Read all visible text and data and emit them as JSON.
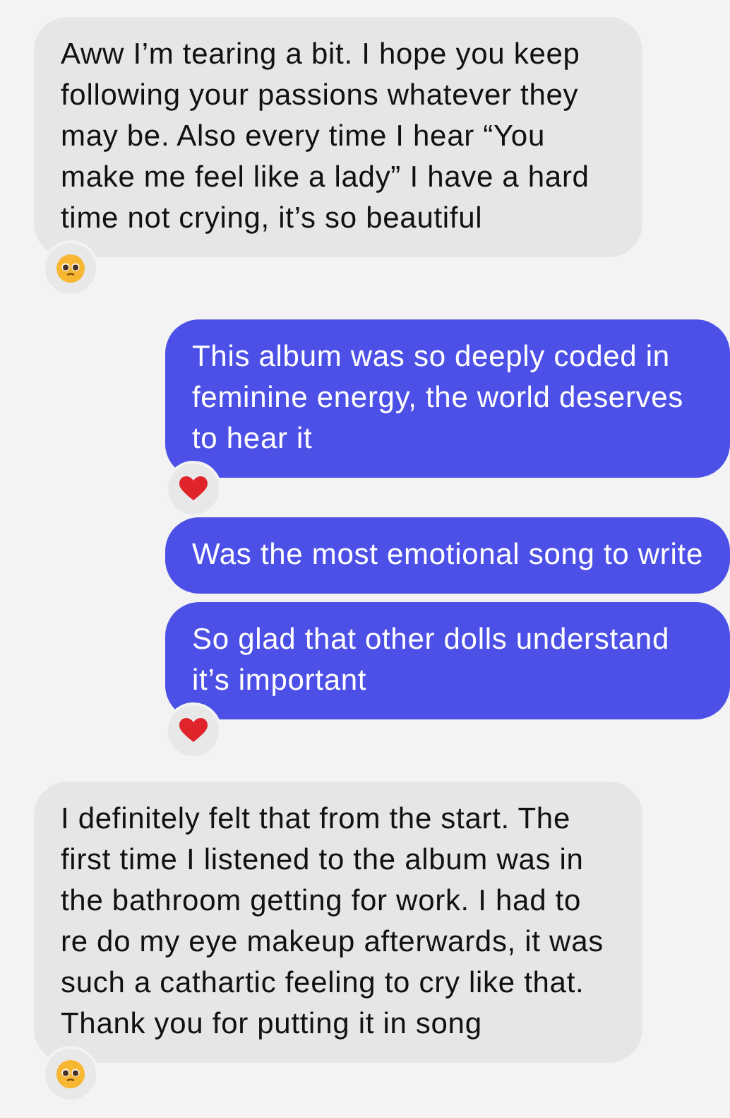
{
  "messages": [
    {
      "kind": "incoming",
      "text": "Aww I’m tearing a bit. I hope you keep following your passions whatever they may be. Also every time I hear “You make me feel like a lady” I have a hard time not crying, it’s so beautiful",
      "reaction": {
        "kind": "pleading"
      }
    },
    {
      "kind": "outgoing",
      "text": "This album was so deeply coded in feminine energy, the world deserves to hear it",
      "reaction": {
        "kind": "heart"
      }
    },
    {
      "kind": "outgoing",
      "text": "Was the most emotional song to write"
    },
    {
      "kind": "outgoing",
      "text": "So glad that other dolls understand it’s important",
      "reaction": {
        "kind": "heart"
      }
    },
    {
      "kind": "incoming",
      "text": "I definitely felt that from the start. The first time I listened to the album was in the bathroom getting for work. I had to re do my eye makeup afterwards, it was such a cathartic feeling to cry like that. Thank you for putting it in song",
      "reaction": {
        "kind": "pleading"
      }
    }
  ]
}
